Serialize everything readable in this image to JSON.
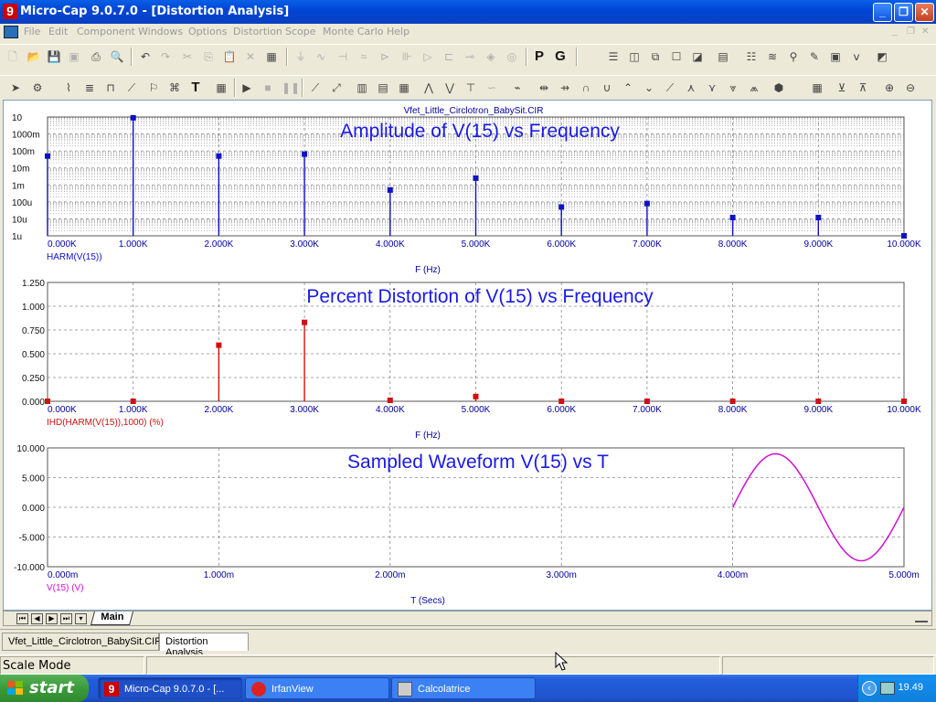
{
  "window": {
    "title": "Micro-Cap 9.0.7.0 - [Distortion Analysis]",
    "app_icon_glyph": "9",
    "controls": {
      "minimize": "_",
      "restore": "❐",
      "close": "✕"
    }
  },
  "menu": [
    "File",
    "Edit",
    "Component",
    "Windows",
    "Options",
    "Distortion",
    "Scope",
    "Monte Carlo",
    "Help"
  ],
  "toolbar1": {
    "p_label": "P",
    "g_label": "G"
  },
  "plot": {
    "file_title": "Vfet_Little_Circlotron_BabySit.CIR",
    "colors": {
      "amplitude": "#1010c8",
      "distortion": "#d01010",
      "waveform": "#d010d0",
      "title": "#1a1ae6",
      "axis_text": "#0000a0",
      "grid": "#8a8a8a"
    }
  },
  "chart_data": [
    {
      "type": "bar",
      "title": "Amplitude of V(15) vs Frequency",
      "xlabel": "F (Hz)",
      "ylabel": "HARM(V(15))",
      "xlim": [
        0,
        10000
      ],
      "yscale": "log",
      "ylim": [
        1e-06,
        10
      ],
      "x_tick_labels": [
        "0.000K",
        "1.000K",
        "2.000K",
        "3.000K",
        "4.000K",
        "5.000K",
        "6.000K",
        "7.000K",
        "8.000K",
        "9.000K",
        "10.000K"
      ],
      "y_tick_labels": [
        "10",
        "1000m",
        "100m",
        "10m",
        "1m",
        "100u",
        "10u",
        "1u"
      ],
      "x": [
        0,
        1000,
        2000,
        3000,
        4000,
        5000,
        6000,
        7000,
        8000,
        9000,
        10000
      ],
      "values": [
        0.05,
        9,
        0.05,
        0.065,
        0.0005,
        0.0025,
        5e-05,
        8e-05,
        1.2e-05,
        1.2e-05,
        1e-06
      ],
      "grid": true
    },
    {
      "type": "bar",
      "title": "Percent Distortion of V(15) vs Frequency",
      "xlabel": "F (Hz)",
      "ylabel": "IHD(HARM(V(15)),1000) (%)",
      "xlim": [
        0,
        10000
      ],
      "ylim": [
        0,
        1.25
      ],
      "x_tick_labels": [
        "0.000K",
        "1.000K",
        "2.000K",
        "3.000K",
        "4.000K",
        "5.000K",
        "6.000K",
        "7.000K",
        "8.000K",
        "9.000K",
        "10.000K"
      ],
      "y_tick_labels": [
        "1.250",
        "1.000",
        "0.750",
        "0.500",
        "0.250",
        "0.000"
      ],
      "x": [
        0,
        1000,
        2000,
        3000,
        4000,
        5000,
        6000,
        7000,
        8000,
        9000,
        10000
      ],
      "values": [
        0,
        0,
        0.59,
        0.83,
        0.01,
        0.05,
        0,
        0,
        0,
        0,
        0
      ],
      "grid": true
    },
    {
      "type": "line",
      "title": "Sampled Waveform  V(15) vs T",
      "xlabel": "T (Secs)",
      "ylabel": "V(15) (V)",
      "xlim": [
        0,
        0.005
      ],
      "ylim": [
        -10,
        10
      ],
      "x_tick_labels": [
        "0.000m",
        "1.000m",
        "2.000m",
        "3.000m",
        "4.000m",
        "5.000m"
      ],
      "y_tick_labels": [
        "10.000",
        "5.000",
        "0.000",
        "-5.000",
        "-10.000"
      ],
      "series": [
        {
          "signal": "sine",
          "t_start": 0.004,
          "t_end": 0.005,
          "amplitude": 9.0,
          "frequency_hz": 1000
        }
      ],
      "grid": true
    }
  ],
  "tabs": {
    "main": "Main"
  },
  "doc_tabs": [
    "Vfet_Little_Circlotron_BabySit.CIR",
    "Distortion Analysis"
  ],
  "status": {
    "mode": "Scale Mode"
  },
  "taskbar": {
    "start": "start",
    "tasks": [
      "Micro-Cap 9.0.7.0 - [...",
      "IrfanView",
      "Calcolatrice"
    ],
    "clock": "19.49"
  }
}
